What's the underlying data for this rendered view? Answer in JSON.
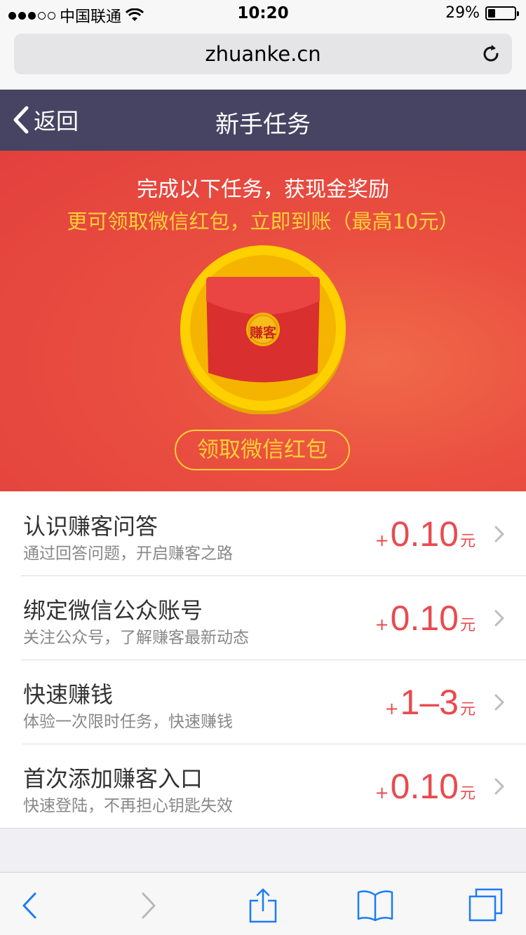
{
  "status_bar": {
    "carrier": "中国联通",
    "time": "10:20",
    "battery_percent": "29%",
    "battery_level": 0.29,
    "icons": [
      "signal-dots-icon",
      "wifi-icon",
      "battery-icon"
    ]
  },
  "browser": {
    "url": "zhuanke.cn",
    "reload_icon": "reload-icon"
  },
  "navbar": {
    "back_label": "返回",
    "title": "新手任务",
    "background": "#464462"
  },
  "banner": {
    "line1": "完成以下任务，获现金奖励",
    "line2": "更可领取微信红包，立即到账（最高10元）",
    "envelope_label": "赚客",
    "claim_button": "领取微信红包",
    "background": "#e2403d",
    "accent": "#ffd035"
  },
  "tasks": [
    {
      "name": "认识赚客问答",
      "desc": "通过回答问题，开启赚客之路",
      "plus": "+",
      "amount": "0.10",
      "unit": "元"
    },
    {
      "name": "绑定微信公众账号",
      "desc": "关注公众号，了解赚客最新动态",
      "plus": "+",
      "amount": "0.10",
      "unit": "元"
    },
    {
      "name": "快速赚钱",
      "desc": "体验一次限时任务，快速赚钱",
      "plus": "+",
      "amount": "1–3",
      "unit": "元"
    },
    {
      "name": "首次添加赚客入口",
      "desc": "快速登陆，不再担心钥匙失效",
      "plus": "+",
      "amount": "0.10",
      "unit": "元"
    }
  ],
  "colors": {
    "reward": "#e84b4f",
    "toolbar_icon": "#1a7cf5"
  },
  "toolbar": {
    "icons": [
      "back-arrow-icon",
      "forward-arrow-icon",
      "share-icon",
      "bookmarks-icon",
      "tabs-icon"
    ]
  }
}
